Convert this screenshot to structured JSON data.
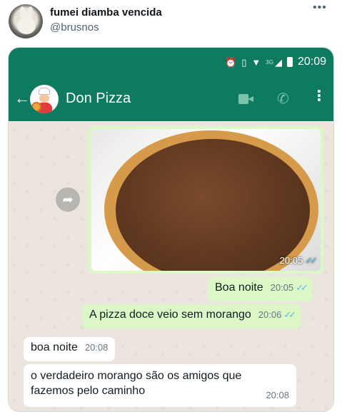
{
  "tweet": {
    "display_name": "fumei diamba vencida",
    "handle": "@brusnos",
    "more_icon": "more-horizontal-icon"
  },
  "whatsapp": {
    "status_bar": {
      "time": "20:09",
      "network_label": "3G",
      "icons": [
        "alarm-icon",
        "vibrate-icon",
        "wifi-icon",
        "signal-icon",
        "battery-icon"
      ]
    },
    "header": {
      "contact_name": "Don Pizza",
      "icons": [
        "back-arrow-icon",
        "video-call-icon",
        "phone-icon",
        "menu-dots-icon"
      ],
      "colors": {
        "bar": "#0e7a5f",
        "icon_muted": "#7bc4ac"
      }
    },
    "messages": [
      {
        "type": "image",
        "direction": "out",
        "time": "20:05",
        "status": "read"
      },
      {
        "type": "text",
        "direction": "out",
        "text": "Boa noite",
        "time": "20:05",
        "status": "read"
      },
      {
        "type": "text",
        "direction": "out",
        "text": "A pizza doce veio sem morango",
        "time": "20:06",
        "status": "read"
      },
      {
        "type": "text",
        "direction": "in",
        "text": "boa noite",
        "time": "20:08"
      },
      {
        "type": "text",
        "direction": "in",
        "text": "o verdadeiro morango são os amigos que fazemos pelo caminho",
        "time": "20:08"
      }
    ],
    "colors": {
      "outgoing_bubble": "#dcf8c6",
      "incoming_bubble": "#ffffff",
      "read_ticks": "#53bdeb"
    }
  }
}
